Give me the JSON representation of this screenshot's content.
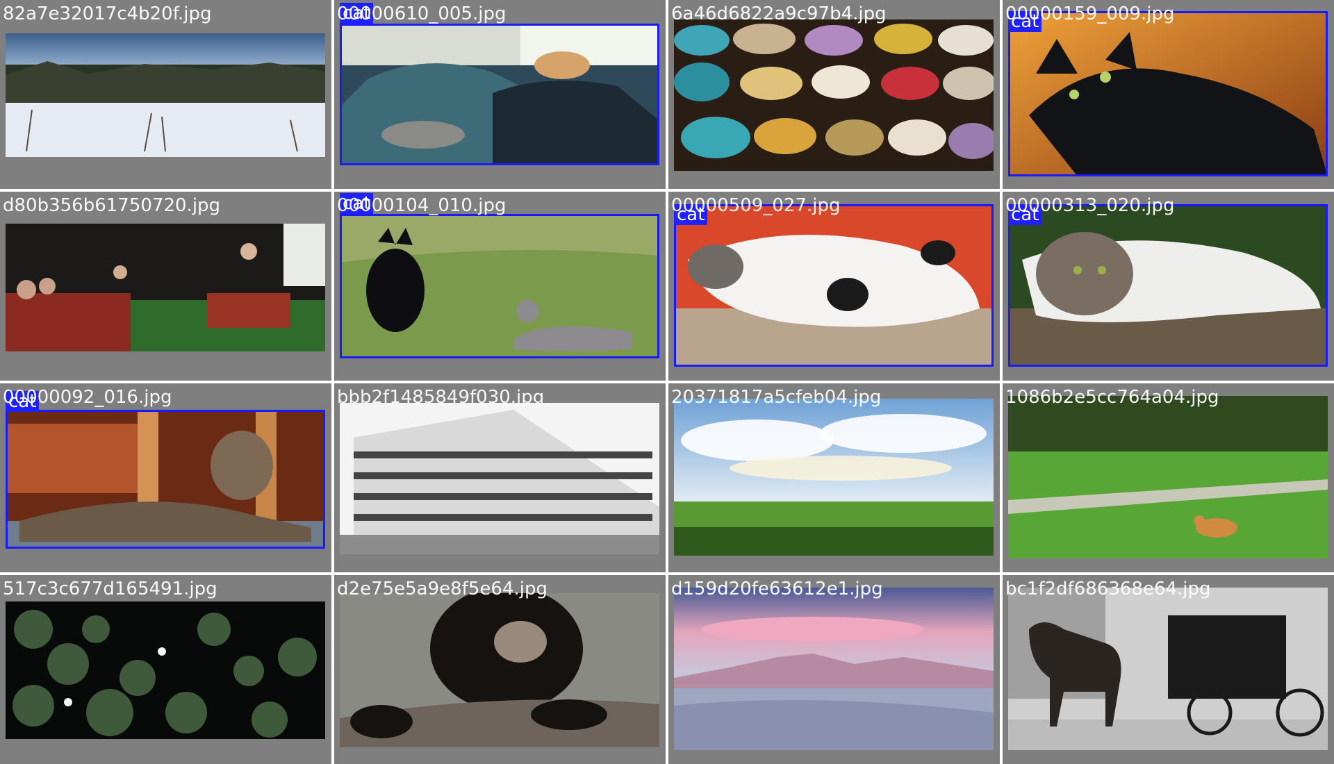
{
  "colors": {
    "tile_background": "#7f7f7f",
    "bbox_color": "#1a1aff",
    "label_background": "#1f22ff",
    "filename_color": "#ffffff"
  },
  "tiles": [
    {
      "filename": "82a7e32017c4b20f.jpg",
      "scene": "snowy-landscape",
      "label": null
    },
    {
      "filename": "00000610_005.jpg",
      "scene": "cats-on-sofa",
      "label": "cat"
    },
    {
      "filename": "6a46d6822a9c97b4.jpg",
      "scene": "carnival-masks",
      "label": null
    },
    {
      "filename": "00000159_009.jpg",
      "scene": "black-cat",
      "label": "cat"
    },
    {
      "filename": "d80b356b61750720.jpg",
      "scene": "classroom",
      "label": null
    },
    {
      "filename": "00000104_010.jpg",
      "scene": "cats-on-grass",
      "label": "cat"
    },
    {
      "filename": "00000509_027.jpg",
      "scene": "cat-on-red-blanket",
      "label": "cat"
    },
    {
      "filename": "00000313_020.jpg",
      "scene": "cat-on-bench",
      "label": "cat"
    },
    {
      "filename": "00000092_016.jpg",
      "scene": "tabby-under-table",
      "label": "cat"
    },
    {
      "filename": "bbb2f1485849f030.jpg",
      "scene": "modern-building",
      "label": null
    },
    {
      "filename": "20371817a5cfeb04.jpg",
      "scene": "green-field-clouds",
      "label": null
    },
    {
      "filename": "1086b2e5cc764a04.jpg",
      "scene": "park-dog",
      "label": null
    },
    {
      "filename": "517c3c677d165491.jpg",
      "scene": "water-lilies",
      "label": null
    },
    {
      "filename": "d2e75e5a9e8f5e64.jpg",
      "scene": "bear",
      "label": null
    },
    {
      "filename": "d159d20fe63612e1.jpg",
      "scene": "pink-sunset-mountains",
      "label": null
    },
    {
      "filename": "bc1f2df686368e64.jpg",
      "scene": "horse-buggy",
      "label": null
    }
  ]
}
